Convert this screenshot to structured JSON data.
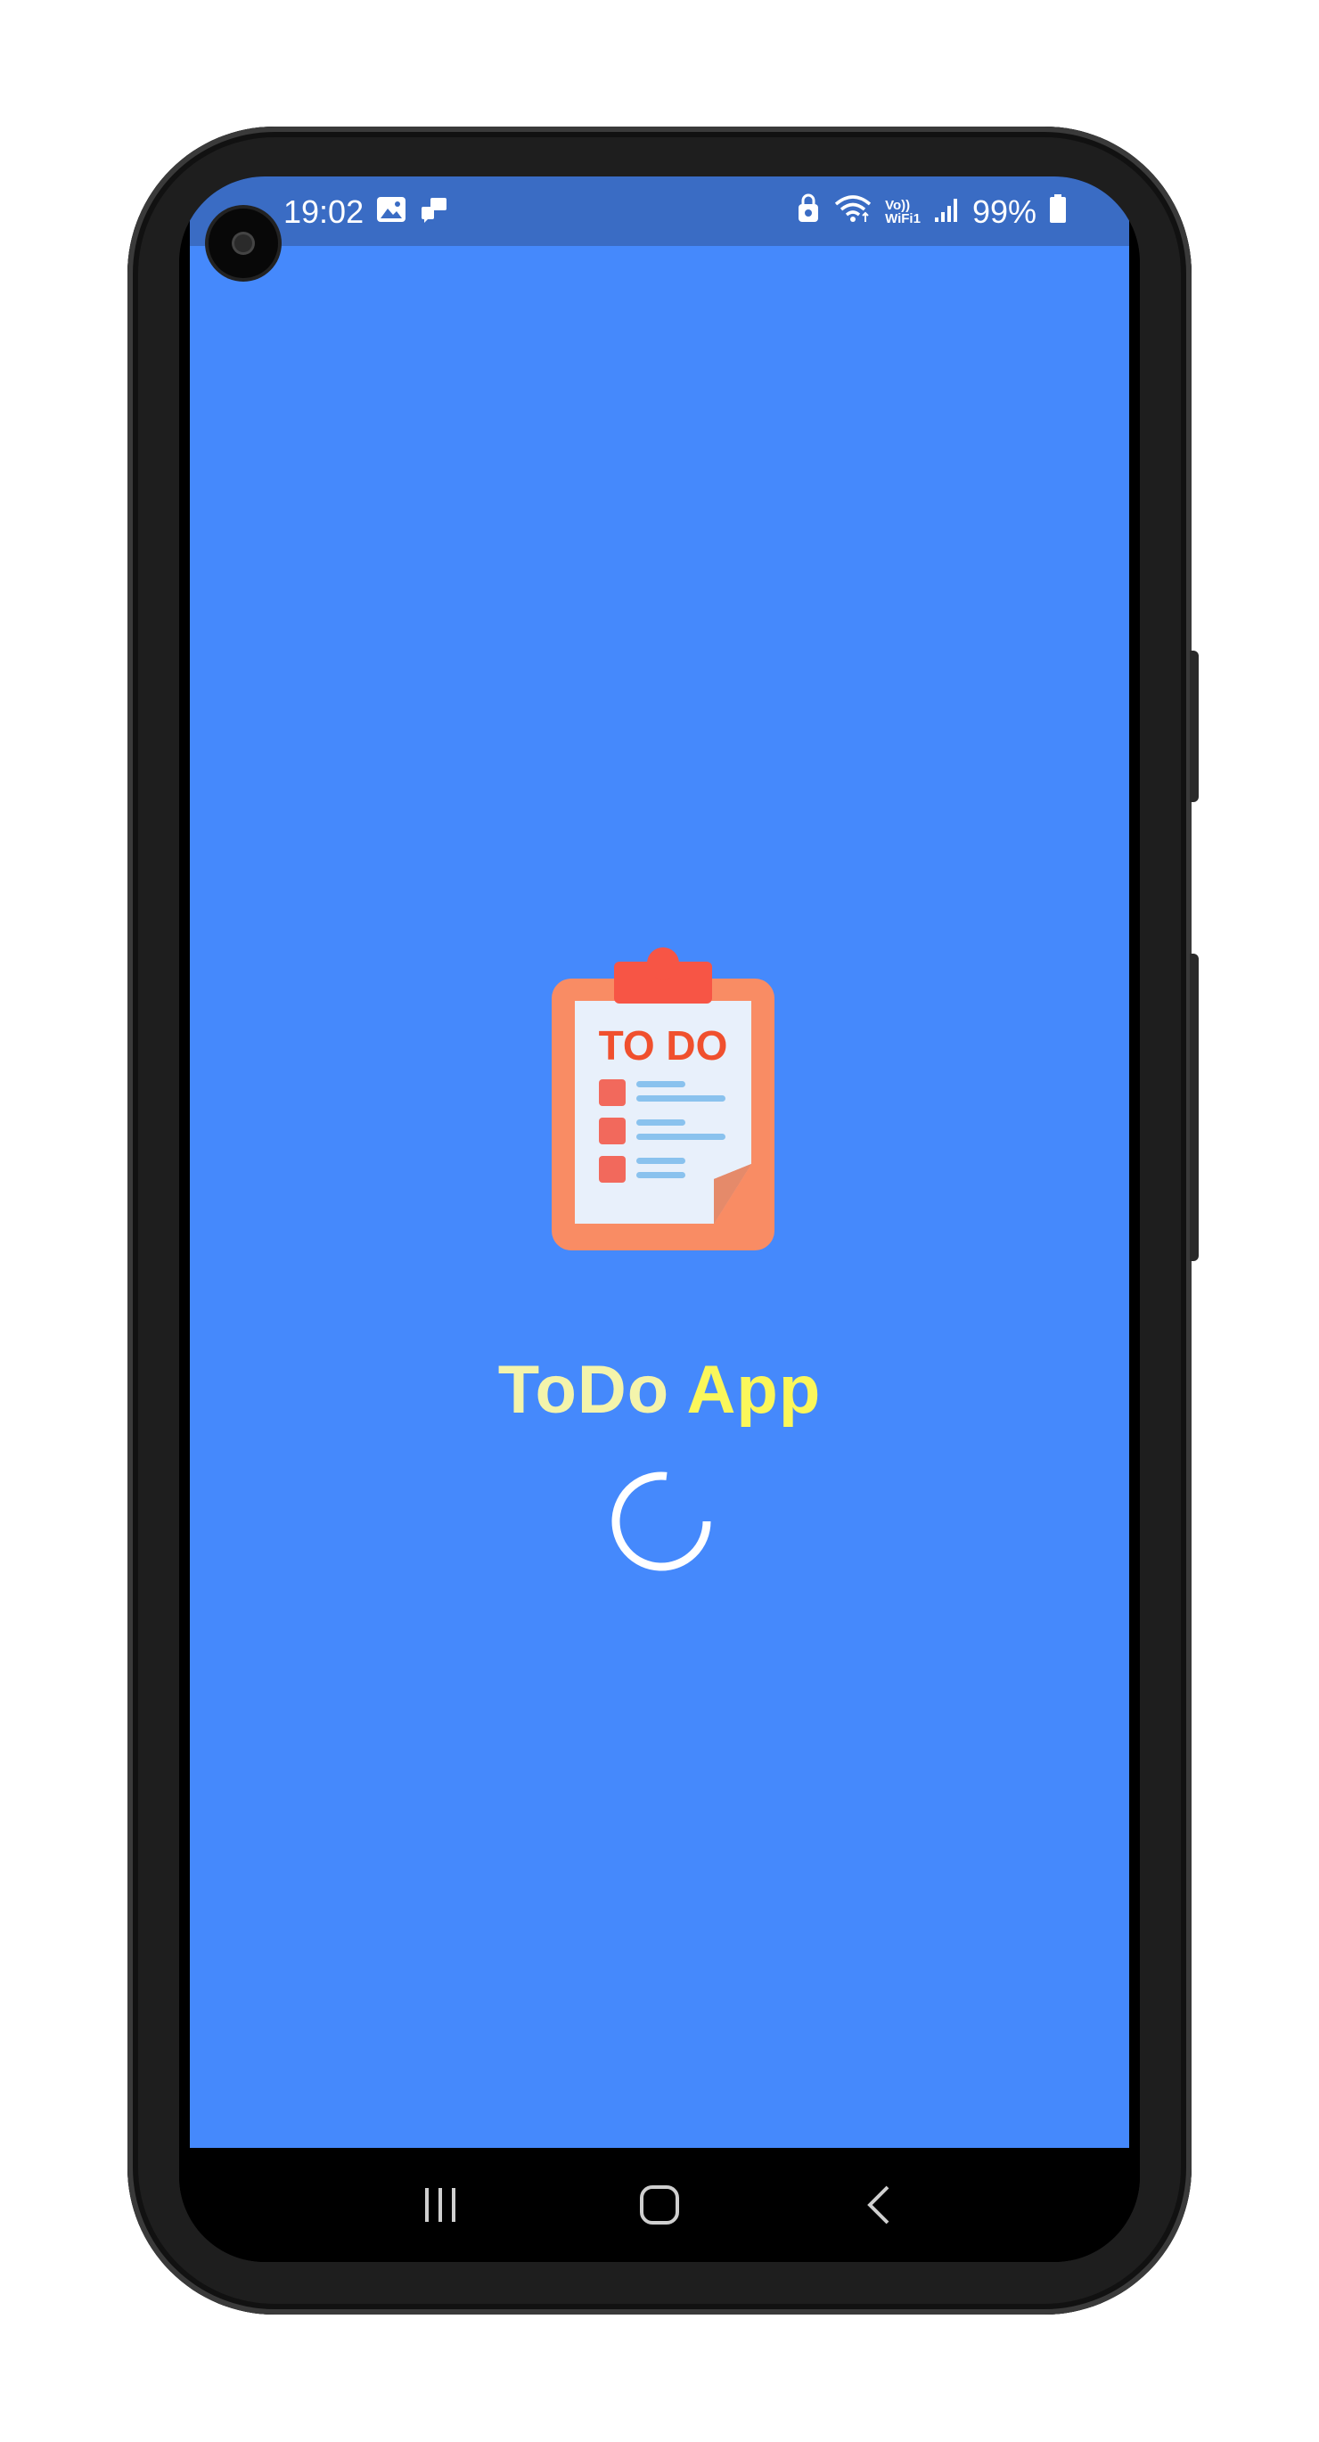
{
  "status_bar": {
    "time": "19:02",
    "battery": "99%",
    "icons": [
      "gallery-icon",
      "notification-icon",
      "vpn-lock-icon",
      "wifi-icon",
      "volte-wifi-icon",
      "signal-icon",
      "battery-icon"
    ],
    "volte_label": "Vo))",
    "wifi_label": "WiFi1"
  },
  "splash": {
    "logo_text": "TO DO",
    "title_part1": "ToDo",
    "title_part2": "App",
    "background_color": "#4589fc",
    "title_color": "#fbf75a"
  },
  "nav_bar": {
    "buttons": [
      "recent-apps-icon",
      "home-icon",
      "back-icon"
    ]
  }
}
